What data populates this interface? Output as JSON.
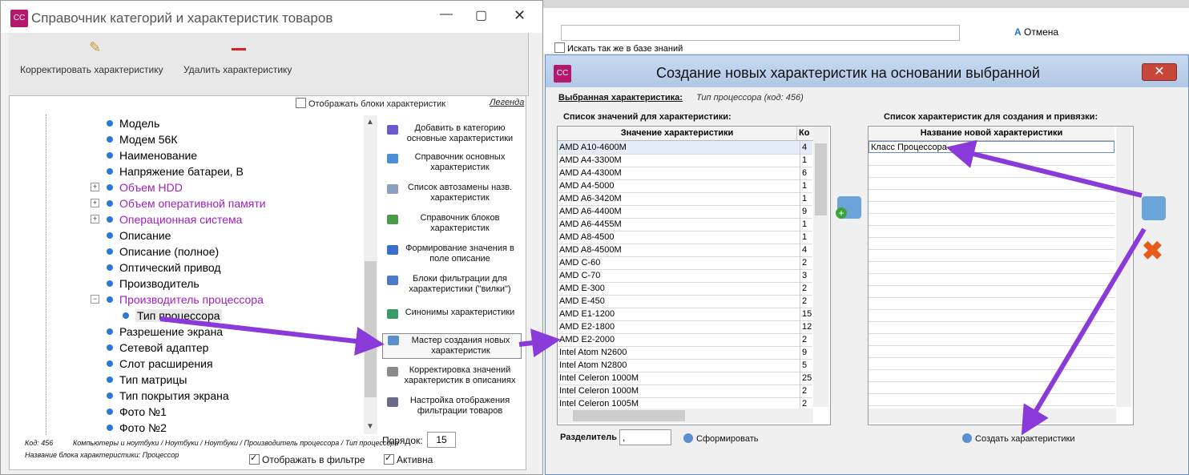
{
  "background": {
    "cancel_label": "Отмена",
    "kb_search_label": "Искать так же в базе знаний"
  },
  "left_window": {
    "app_icon": "CC",
    "title": "Справочник категорий и характеристик товаров",
    "toolbar": {
      "edit_label": "Корректировать характеристику",
      "delete_label": "Удалить характеристику"
    },
    "show_blocks_label": "Отображать блоки характеристик",
    "legend_link": "Легенда",
    "tree": [
      {
        "label": "Модель",
        "type": "leaf"
      },
      {
        "label": "Модем 56К",
        "type": "leaf"
      },
      {
        "label": "Наименование",
        "type": "leaf"
      },
      {
        "label": "Напряжение батареи, В",
        "type": "leaf"
      },
      {
        "label": "Объем HDD",
        "type": "category"
      },
      {
        "label": "Объем оперативной памяти",
        "type": "category"
      },
      {
        "label": "Операционная система",
        "type": "category"
      },
      {
        "label": "Описание",
        "type": "leaf"
      },
      {
        "label": "Описание (полное)",
        "type": "leaf"
      },
      {
        "label": "Оптический привод",
        "type": "leaf"
      },
      {
        "label": "Производитель",
        "type": "leaf"
      },
      {
        "label": "Производитель процессора",
        "type": "category-open"
      },
      {
        "label": "Тип процессора",
        "type": "child-selected"
      },
      {
        "label": "Разрешение экрана",
        "type": "leaf"
      },
      {
        "label": "Сетевой адаптер",
        "type": "leaf"
      },
      {
        "label": "Слот расширения",
        "type": "leaf"
      },
      {
        "label": "Тип матрицы",
        "type": "leaf"
      },
      {
        "label": "Тип покрытия экрана",
        "type": "leaf"
      },
      {
        "label": "Фото №1",
        "type": "leaf"
      },
      {
        "label": "Фото №2",
        "type": "leaf"
      }
    ],
    "side_menu": [
      "Добавить в категорию основные характеристики",
      "Справочник основных характеристик",
      "Список автозамены назв. характеристик",
      "Справочник блоков характеристик",
      "Формирование значения в поле описание",
      "Блоки фильтрации для характеристики (\"вилки\")",
      "Синонимы характеристики",
      "Мастер создания новых характеристик",
      "Корректировка значений характеристик в описаниях",
      "Настройка отображения фильтрации товаров"
    ],
    "status": {
      "code": "Код: 456",
      "path": "Компьютеры и ноутбуки / Ноутбуки / Ноутбуки / Производитель процессора / Тип процессора",
      "block": "Название блока характеристики: Процессор"
    },
    "order_label": "Порядок:",
    "order_value": "15",
    "filter_label": "Отображать в фильтре",
    "active_label": "Активна"
  },
  "dialog": {
    "app_icon": "CC",
    "title": "Создание новых характеристик на основании выбранной",
    "close_label": "✕",
    "selected_label": "Выбранная характеристика:",
    "selected_value": "Тип процессора (код: 456)",
    "values_heading": "Список значений для характеристики:",
    "values_col_value": "Значение характеристики",
    "values_col_count": "Ко",
    "values": [
      {
        "v": "AMD A10-4600M",
        "c": "4"
      },
      {
        "v": "AMD A4-3300M",
        "c": "1"
      },
      {
        "v": "AMD A4-4300M",
        "c": "6"
      },
      {
        "v": "AMD A4-5000",
        "c": "1"
      },
      {
        "v": "AMD A6-3420M",
        "c": "1"
      },
      {
        "v": "AMD A6-4400M",
        "c": "9"
      },
      {
        "v": "AMD A6-4455M",
        "c": "1"
      },
      {
        "v": "AMD A8-4500",
        "c": "1"
      },
      {
        "v": "AMD A8-4500M",
        "c": "4"
      },
      {
        "v": "AMD C-60",
        "c": "2"
      },
      {
        "v": "AMD C-70",
        "c": "3"
      },
      {
        "v": "AMD E-300",
        "c": "2"
      },
      {
        "v": "AMD E-450",
        "c": "2"
      },
      {
        "v": "AMD E1-1200",
        "c": "15"
      },
      {
        "v": "AMD E2-1800",
        "c": "12"
      },
      {
        "v": "AMD E2-2000",
        "c": "2"
      },
      {
        "v": "Intel Atom N2600",
        "c": "9"
      },
      {
        "v": "Intel Atom N2800",
        "c": "5"
      },
      {
        "v": "Intel Celeron 1000M",
        "c": "25"
      },
      {
        "v": "Intel Celeron 1000M",
        "c": "2"
      },
      {
        "v": "Intel Celeron 1005M",
        "c": "2"
      }
    ],
    "new_heading": "Список характеристик для создания и привязки:",
    "new_col": "Название новой характеристики",
    "new_items": [
      "Класс Процессора"
    ],
    "separator_label": "Разделитель",
    "separator_value": ",",
    "form_label": "Сформировать",
    "create_label": "Создать характеристики"
  }
}
